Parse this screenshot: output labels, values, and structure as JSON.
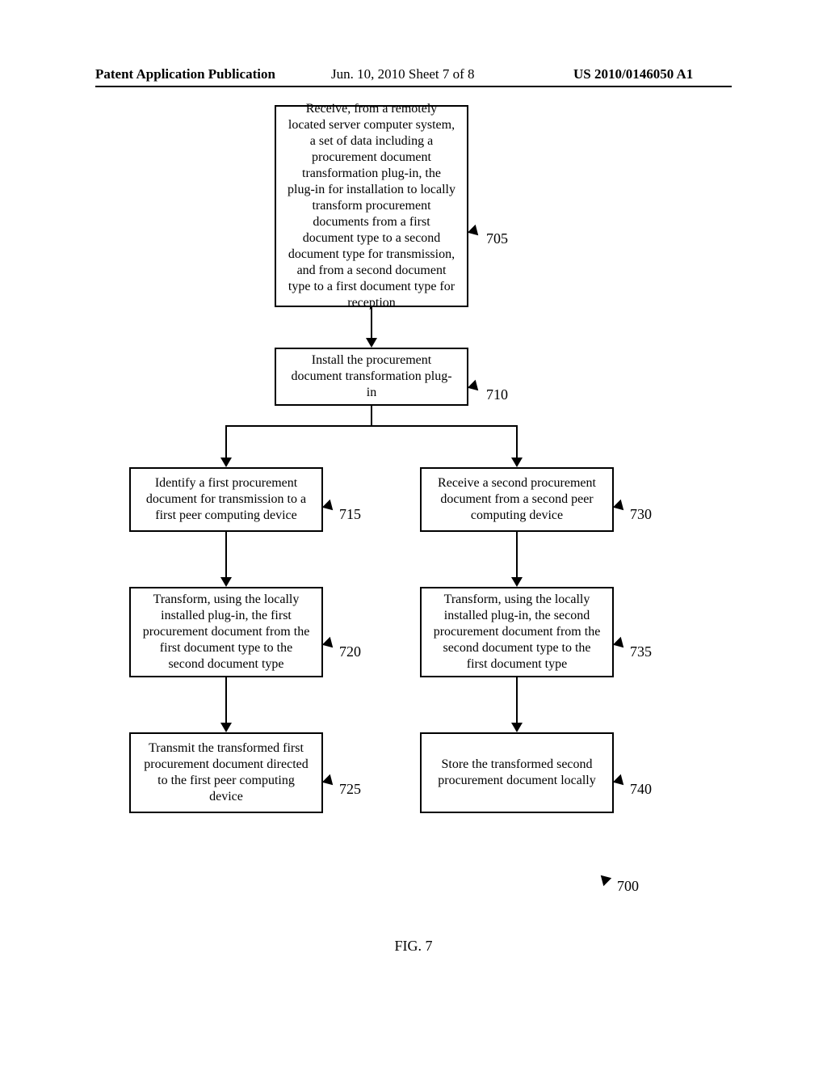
{
  "header": {
    "left": "Patent Application Publication",
    "mid": "Jun. 10, 2010  Sheet 7 of 8",
    "right": "US 2010/0146050 A1"
  },
  "boxes": {
    "b705": "Receive, from a remotely located server computer system, a set of data including a procurement document transformation plug-in, the plug-in for installation to locally transform procurement documents from a first document type to a second document type for transmission, and from a second document type to a first document type for reception",
    "b710": "Install the procurement document transformation plug-in",
    "b715": "Identify a first procurement document for transmission to a first peer computing device",
    "b720": "Transform, using the locally installed plug-in, the first procurement document from the first document type to the second document type",
    "b725": "Transmit the transformed first procurement document directed to the first peer computing device",
    "b730": "Receive a second procurement document from a second peer computing device",
    "b735": "Transform, using the locally installed plug-in, the second procurement document from the second document type to the first document type",
    "b740": "Store the transformed second procurement document locally"
  },
  "labels": {
    "l705": "705",
    "l710": "710",
    "l715": "715",
    "l720": "720",
    "l725": "725",
    "l730": "730",
    "l735": "735",
    "l740": "740",
    "l700": "700"
  },
  "figure": "FIG.   7"
}
